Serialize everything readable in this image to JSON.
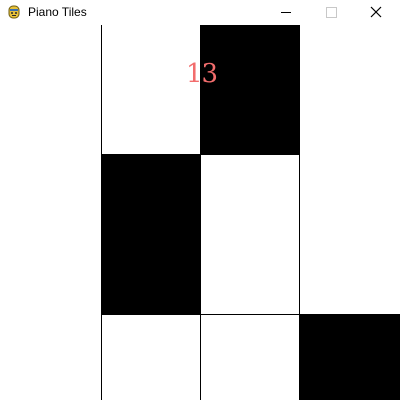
{
  "window": {
    "title": "Piano Tiles",
    "app_icon": "pygame-snake-icon",
    "controls": [
      "minimize-icon",
      "maximize-icon",
      "close-icon"
    ]
  },
  "game": {
    "score": "13",
    "colors": {
      "score": "#f26d6d",
      "tile": "#000000",
      "background": "#ffffff",
      "grid": "#000000"
    },
    "columns": 4,
    "tiles": [
      {
        "column": 3,
        "row": 1
      },
      {
        "column": 2,
        "row": 2
      },
      {
        "column": 4,
        "row": 3
      }
    ]
  }
}
